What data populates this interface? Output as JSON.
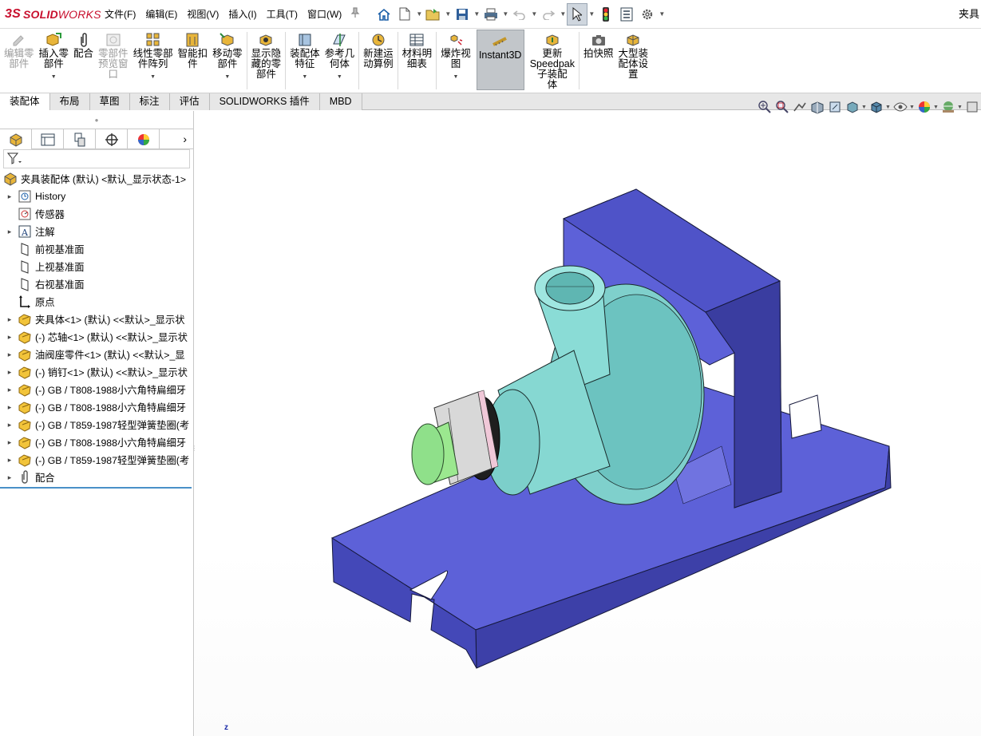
{
  "app": {
    "logo_ds": "3S",
    "logo_solid": "SOLID",
    "logo_works": "WORKS",
    "title_text": "夹具"
  },
  "menu": [
    "文件(F)",
    "编辑(E)",
    "视图(V)",
    "插入(I)",
    "工具(T)",
    "窗口(W)"
  ],
  "quick_access": [
    "home-icon",
    "new-document-icon",
    "open-folder-icon",
    "save-icon",
    "print-icon",
    "undo-icon",
    "redo-icon",
    "select-cursor-icon",
    "traffic-light-icon",
    "file-properties-icon",
    "options-gear-icon"
  ],
  "commands": [
    {
      "label": "编辑零\n部件",
      "disabled": true
    },
    {
      "label": "插入零\n部件",
      "dropdown": true
    },
    {
      "label": "配合"
    },
    {
      "label": "零部件\n预览窗\n口",
      "disabled": true
    },
    {
      "label": "线性零部\n件阵列",
      "dropdown": true
    },
    {
      "label": "智能扣\n件"
    },
    {
      "label": "移动零\n部件",
      "dropdown": true
    },
    {
      "label": "显示隐\n藏的零\n部件"
    },
    {
      "label": "装配体\n特征",
      "dropdown": true
    },
    {
      "label": "参考几\n何体",
      "dropdown": true
    },
    {
      "label": "新建运\n动算例"
    },
    {
      "label": "材料明\n细表"
    },
    {
      "label": "爆炸视\n图",
      "dropdown": true
    },
    {
      "label": "Instant3D",
      "active": true
    },
    {
      "label": "更新\nSpeedpak\n子装配\n体"
    },
    {
      "label": "拍快照"
    },
    {
      "label": "大型装\n配体设\n置"
    }
  ],
  "tabs": [
    "装配体",
    "布局",
    "草图",
    "标注",
    "评估",
    "SOLIDWORKS 插件",
    "MBD"
  ],
  "active_tab": "装配体",
  "tree": {
    "root": "夹具装配体 (默认) <默认_显示状态-1>",
    "nodes": [
      {
        "label": "History",
        "icon": "history-icon",
        "expand": true
      },
      {
        "label": "传感器",
        "icon": "sensor-icon",
        "expand": false
      },
      {
        "label": "注解",
        "icon": "annotation-icon",
        "expand": true
      },
      {
        "label": "前视基准面",
        "icon": "plane-icon",
        "expand": false
      },
      {
        "label": "上视基准面",
        "icon": "plane-icon",
        "expand": false
      },
      {
        "label": "右视基准面",
        "icon": "plane-icon",
        "expand": false
      },
      {
        "label": "原点",
        "icon": "origin-icon",
        "expand": false
      },
      {
        "label": "夹具体<1> (默认) <<默认>_显示状",
        "icon": "part-icon",
        "expand": true
      },
      {
        "label": "(-) 芯轴<1> (默认) <<默认>_显示状",
        "icon": "part-icon",
        "expand": true
      },
      {
        "label": "油阀座零件<1> (默认) <<默认>_显",
        "icon": "part-icon",
        "expand": true
      },
      {
        "label": "(-) 销钉<1> (默认) <<默认>_显示状",
        "icon": "part-icon",
        "expand": true
      },
      {
        "label": "(-) GB / T808-1988小六角特扁细牙",
        "icon": "part-icon",
        "expand": true
      },
      {
        "label": "(-) GB / T808-1988小六角特扁细牙",
        "icon": "part-icon",
        "expand": true
      },
      {
        "label": "(-) GB / T859-1987轻型弹簧垫圈(考",
        "icon": "part-icon",
        "expand": true
      },
      {
        "label": "(-) GB / T808-1988小六角特扁细牙",
        "icon": "part-icon",
        "expand": true
      },
      {
        "label": "(-) GB / T859-1987轻型弹簧垫圈(考",
        "icon": "part-icon",
        "expand": true
      },
      {
        "label": "配合",
        "icon": "mates-icon",
        "expand": true
      }
    ]
  },
  "viewport": {
    "axis_label": "z"
  },
  "colors": {
    "bracket": "#5b5fd6",
    "bracket_dark": "#3c3fa8",
    "valve": "#7fd6d0",
    "shaft_end": "#8fe08a",
    "accent": "#c8102e"
  }
}
